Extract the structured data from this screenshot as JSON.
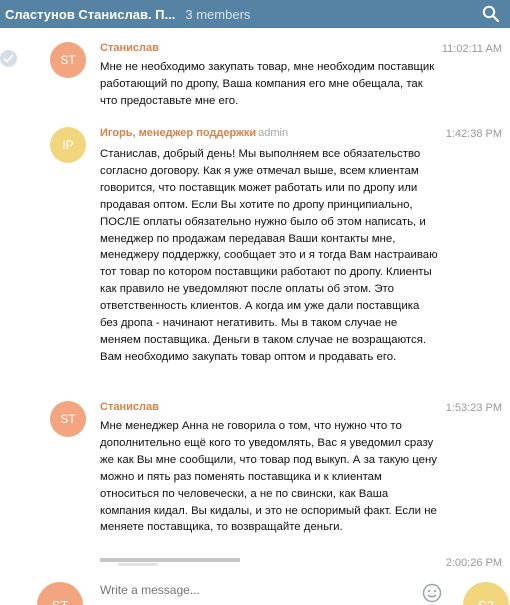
{
  "header": {
    "title": "Сластунов Станислав. П...",
    "members": "3 members",
    "icon": "search-icon"
  },
  "messages": [
    {
      "initials": "ST",
      "author": "Станислав",
      "role": "",
      "time": "11:02:11 AM",
      "text": "Мне не необходимо закупать товар, мне необходим поставщик работающий по дропу, Ваша компания его мне обещала, так что предоставьте мне его."
    },
    {
      "initials": "IP",
      "author": "Игорь, менеджер поддержки",
      "role": "admin",
      "time": "1:42:38 PM",
      "text": "Станислав, добрый день! Мы выполняем все обязательство согласно договору.  Как я уже отмечал выше, всем клиентам говорится, что поставщик может работать или по дропу или продавая оптом. Если Вы хотите по дропу принципиально, ПОСЛЕ оплаты обязательно нужно было об этом написать, и менеджер по продажам передавая Ваши контакты мне, менеджеру поддержку, сообщает это и я тогда Вам настраиваю тот товар по котором поставщики работают по дропу. Клиенты как правило не уведомляют после оплаты об этом. Это ответственность клиентов. А когда им уже дали поставщика без дропа - начинают негативить. Мы в таком случае не меняем поставщика. Деньги в таком случае не возращаются. Вам необходимо закупать товар оптом и продавать его."
    },
    {
      "initials": "ST",
      "author": "Станислав",
      "role": "",
      "time": "1:53:23 PM",
      "text": "Мне менеджер Анна не говорила о том, что нужно что то дополнительно ещё кого то уведомлять, Вас я уведомил сразу же как Вы мне сообщили, что товар под выкуп. А за такую цену можно и пять раз поменять поставщика и к клиентам относиться по человечески, а не по свински, как Ваша компания кидал. Вы кидалы, и это не оспоримый факт. Если не меняете поставщика, то возвращайте деньги."
    }
  ],
  "partial_message": {
    "time": "2:00:26 PM"
  },
  "composer": {
    "placeholder": "Write a message...",
    "left_initials": "ST",
    "right_initials": "S2"
  }
}
